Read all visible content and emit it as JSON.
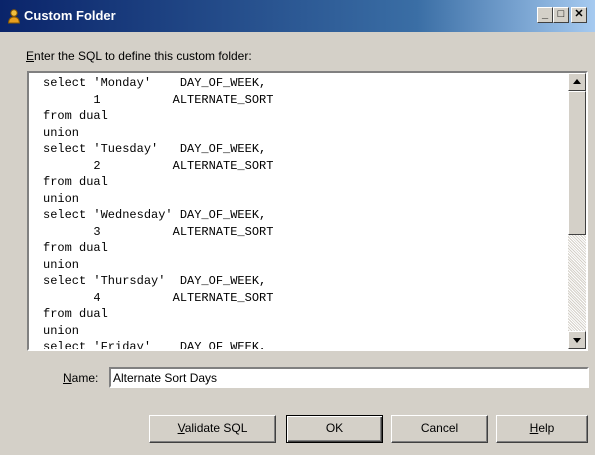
{
  "window": {
    "title": "Custom Folder",
    "controls": {
      "minimize": "_",
      "maximize": "□",
      "close": "✕"
    }
  },
  "prompt": {
    "mnemonic": "E",
    "rest": "nter the SQL to define this custom folder:"
  },
  "sql": {
    "text": "select 'Monday'    DAY_OF_WEEK,\n       1          ALTERNATE_SORT\nfrom dual\nunion\nselect 'Tuesday'   DAY_OF_WEEK,\n       2          ALTERNATE_SORT\nfrom dual\nunion\nselect 'Wednesday' DAY_OF_WEEK,\n       3          ALTERNATE_SORT\nfrom dual\nunion\nselect 'Thursday'  DAY_OF_WEEK,\n       4          ALTERNATE_SORT\nfrom dual\nunion\nselect 'Friday'    DAY_OF_WEEK,"
  },
  "name_field": {
    "label_mnemonic": "N",
    "label_rest": "ame:",
    "value": "Alternate Sort Days"
  },
  "buttons": {
    "validate_mnemonic": "V",
    "validate_rest": "alidate SQL",
    "ok": "OK",
    "cancel": "Cancel",
    "help_mnemonic": "H",
    "help_rest": "elp"
  }
}
